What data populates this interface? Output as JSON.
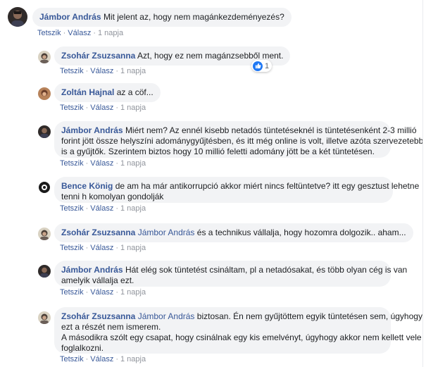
{
  "colors": {
    "link": "#385898",
    "bubble": "#f2f3f5",
    "meta": "#90949c",
    "like": "#2078f4"
  },
  "actions": {
    "like": "Tetszik",
    "reply": "Válasz",
    "sep": "·"
  },
  "top_comment": {
    "author": "Jámbor András",
    "text": "Mit jelent az, hogy nem magánkezdeményezés?",
    "time": "1 napja",
    "avatar_icon": "user-avatar-icon"
  },
  "replies": [
    {
      "author": "Zsohár Zsuzsanna",
      "mention": "",
      "text": "Azt, hogy ez nem magánzsebből ment.",
      "time": "1 napja",
      "reaction_count": "1"
    },
    {
      "author": "Zoltán Hajnal",
      "mention": "",
      "text": "az a cöf...",
      "time": "1 napja"
    },
    {
      "author": "Jámbor András",
      "mention": "",
      "line1": "Miért nem? Az ennél kisebb netadós tüntetéseknél is tüntetésenként 2-3 millió",
      "line2": "forint jött össze helyszíni adománygyűjtésben, és itt még online is volt, illetve azóta szervezetebbek",
      "line3": "is a gyűjtők. Szerintem biztos hogy 10 millió feletti adomány jött be a két tüntetésen.",
      "time": "1 napja"
    },
    {
      "author": "Bence König",
      "mention": "",
      "line1": "de am ha már antikorrupció akkor miért nincs feltüntetve? itt egy gesztust lehetne",
      "line2": "tenni h komolyan gondolják",
      "time": "1 napja"
    },
    {
      "author": "Zsohár Zsuzsanna",
      "mention": "Jámbor András",
      "text": "és a technikus vállalja, hogy hozomra dolgozik.. aham...",
      "time": "1 napja"
    },
    {
      "author": "Jámbor András",
      "mention": "",
      "line1": "Hát elég sok tüntetést csináltam, pl a netadósakat, és több olyan cég is van",
      "line2": "amelyik vállalja ezt.",
      "time": "1 napja"
    },
    {
      "author": "Zsohár Zsuzsanna",
      "mention": "Jámbor András",
      "line1": "biztosan. Én nem gyűjtöttem egyik tüntetésen sem, úgyhogy",
      "line2": "ezt a részét nem ismerem.",
      "line3": "A másodikra szólt egy csapat, hogy csinálnak egy kis emelvényt, úgyhogy akkor nem kellett vele",
      "line4": "foglalkozni.",
      "time": "1 napja"
    }
  ]
}
